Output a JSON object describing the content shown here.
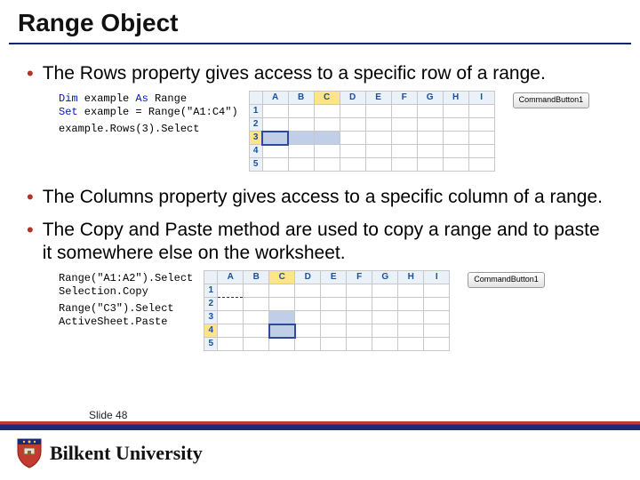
{
  "title": "Range Object",
  "bullets": {
    "rows": "The Rows property gives access to a specific row of a range.",
    "cols": "The Columns property gives access to a specific column of a range.",
    "copy": "The Copy and Paste method are used to copy a range and to paste it somewhere else on the worksheet."
  },
  "code": {
    "dim": "Dim",
    "as": "As",
    "set": "Set",
    "line1_mid": " example ",
    "line1_end": " Range",
    "line2_mid": " example = Range(\"A1:C4\")",
    "line3": "example.Rows(3).Select",
    "c2_l1": "Range(\"A1:A2\").Select",
    "c2_l2": "Selection.Copy",
    "c2_l3": "Range(\"C3\").Select",
    "c2_l4": "ActiveSheet.Paste"
  },
  "sheet": {
    "cols": {
      "A": "A",
      "B": "B",
      "C": "C",
      "D": "D",
      "E": "E",
      "F": "F",
      "G": "G",
      "H": "H",
      "I": "I"
    },
    "rows": {
      "r1": "1",
      "r2": "2",
      "r3": "3",
      "r4": "4",
      "r5": "5"
    },
    "button": "CommandButton1"
  },
  "footer": {
    "slide_label": "Slide 48",
    "university": "Bilkent University"
  }
}
